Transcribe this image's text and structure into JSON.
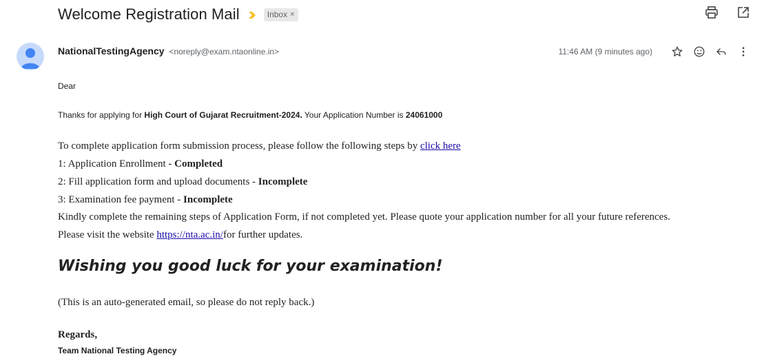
{
  "email": {
    "subject": "Welcome Registration Mail",
    "label": "Inbox",
    "label_close": "×",
    "sender_name": "NationalTestingAgency",
    "sender_email": "<noreply@exam.ntaonline.in>",
    "timestamp": "11:46 AM (9 minutes ago)",
    "icons": [
      "print-icon",
      "open-in-new-window-icon",
      "star-icon",
      "emoji-icon",
      "reply-icon",
      "more-vert-icon"
    ],
    "colors": {
      "important_marker": "#f6bf26",
      "avatar_bg": "#c6dafc",
      "avatar_fg": "#4285f4",
      "link": "#1a0dab"
    }
  },
  "body": {
    "greeting": "Dear",
    "thanks_pre": "Thanks for applying for ",
    "exam_name": "High Court of Gujarat Recruitment-2024.",
    "thanks_mid": " Your Application Number is ",
    "app_number": "24061000",
    "steps_intro": "To complete application form submission process, please follow the following steps by ",
    "steps_link": "click here",
    "steps": [
      {
        "text": "1: Application Enrollment - ",
        "status": "Completed"
      },
      {
        "text": "2: Fill application form and upload documents - ",
        "status": "Incomplete"
      },
      {
        "text": "3: Examination fee payment - ",
        "status": "Incomplete"
      }
    ],
    "kindly": "Kindly complete the remaining steps of Application Form, if not completed yet. Please quote your application number for all your future references.",
    "visit_pre": "Please visit the website ",
    "visit_link": "https://nta.ac.in/",
    "visit_post": "for further updates.",
    "wish": "Wishing you good luck for your examination!",
    "auto_note": "(This is an auto-generated email, so please do not reply back.)",
    "regards": "Regards,",
    "team": "Team National Testing Agency"
  }
}
